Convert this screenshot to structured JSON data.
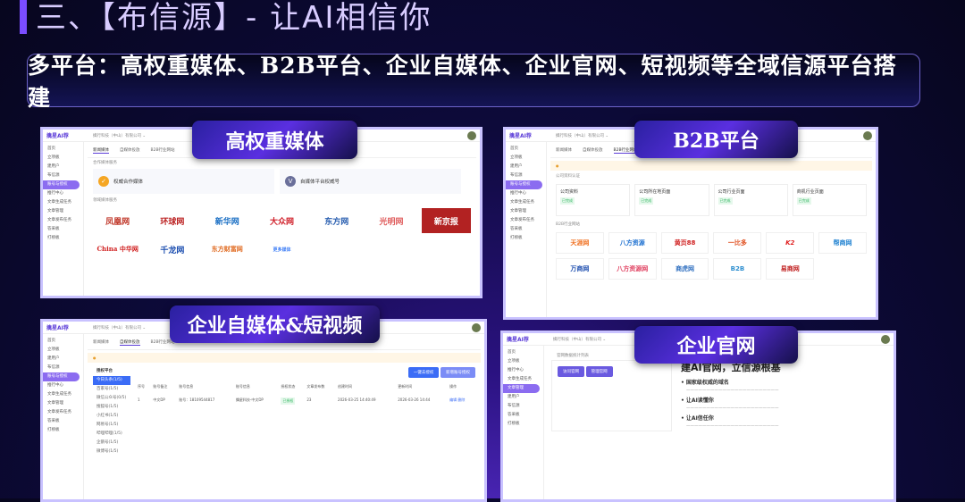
{
  "slide": {
    "title": "三、【布信源】- 让AI相信你",
    "banner": "多平台：高权重媒体、B2B平台、企业自媒体、企业官网、短视频等全域信源平台搭建"
  },
  "app": {
    "brand": "擒星AI荐",
    "company": "擒行科技（中山）有限公司 ⌄",
    "sidebar": [
      "首页",
      "立项板",
      "建用户",
      "布信源",
      "账号与授权",
      "推行中心",
      "文章生成任务",
      "文章管理",
      "文章发布任务",
      "答采板",
      "打榜板"
    ]
  },
  "panels": [
    {
      "label": "高权重媒体",
      "tabs": [
        "新闻媒体",
        "自媒体投放",
        "B2B行业网站"
      ],
      "section1": "合作媒体服务",
      "card1": "权威合作媒体",
      "card2": "自媒体平台权威号",
      "section2": "领域媒体服务",
      "logos": [
        "凤凰网",
        "环球网",
        "新华网",
        "大众网",
        "东方网",
        "光明网",
        "新京报",
        "China 中华网",
        "千龙网",
        "东方财富网",
        "更多媒体"
      ]
    },
    {
      "label": "B2B平台",
      "tabs": [
        "新闻媒体",
        "自媒体投放",
        "B2B行业网站"
      ],
      "section1": "公司资料认证",
      "steps": [
        "公司资料",
        "公司所在地页面",
        "公司行业页面",
        "商机行业页面"
      ],
      "step_tag": "已完成",
      "section2": "B2B行业网站",
      "logos": [
        "天涯网",
        "八方资源",
        "黄页88",
        "一比多",
        "K2",
        "帮商网",
        "万商网",
        "八方资源网",
        "商虎网",
        "B2B",
        "易商网"
      ]
    },
    {
      "label": "企业自媒体&短视频",
      "tabs": [
        "新闻媒体",
        "自媒体投放",
        "B2B行业网站"
      ],
      "platform_title": "授权平台",
      "platforms": [
        "今日头条(1/5)",
        "百家号(1/5)",
        "微信公众号(0/5)",
        "搜狐号(1/5)",
        "小红书(1/5)",
        "网易号(1/5)",
        "哔哩哔哩(1/5)",
        "企鹅号(1/5)",
        "微博号(1/5)"
      ],
      "buttons": [
        "一键去授权",
        "新增账号授权"
      ],
      "columns": [
        "序号",
        "账号备注",
        "账号信息",
        "账号信息",
        "授权状态",
        "文章发布数",
        "创建时间",
        "更新时间",
        "操作"
      ],
      "row": [
        "1",
        "中文DP",
        "账号：18109544817",
        "擒星科技-中文DP",
        "已授权",
        "23",
        "2026-03-25 14:40:49",
        "2026-03-26 14:44",
        "编辑 删除"
      ]
    },
    {
      "label": "企业官网",
      "section": "官网数据统计列表",
      "btns": [
        "访问官网",
        "管理官网"
      ],
      "headline": "建AI官网，立信源根基",
      "h2": [
        "• 国家级权威的域名",
        "• 让AI读懂你",
        "• 让AI信任你"
      ]
    }
  ]
}
